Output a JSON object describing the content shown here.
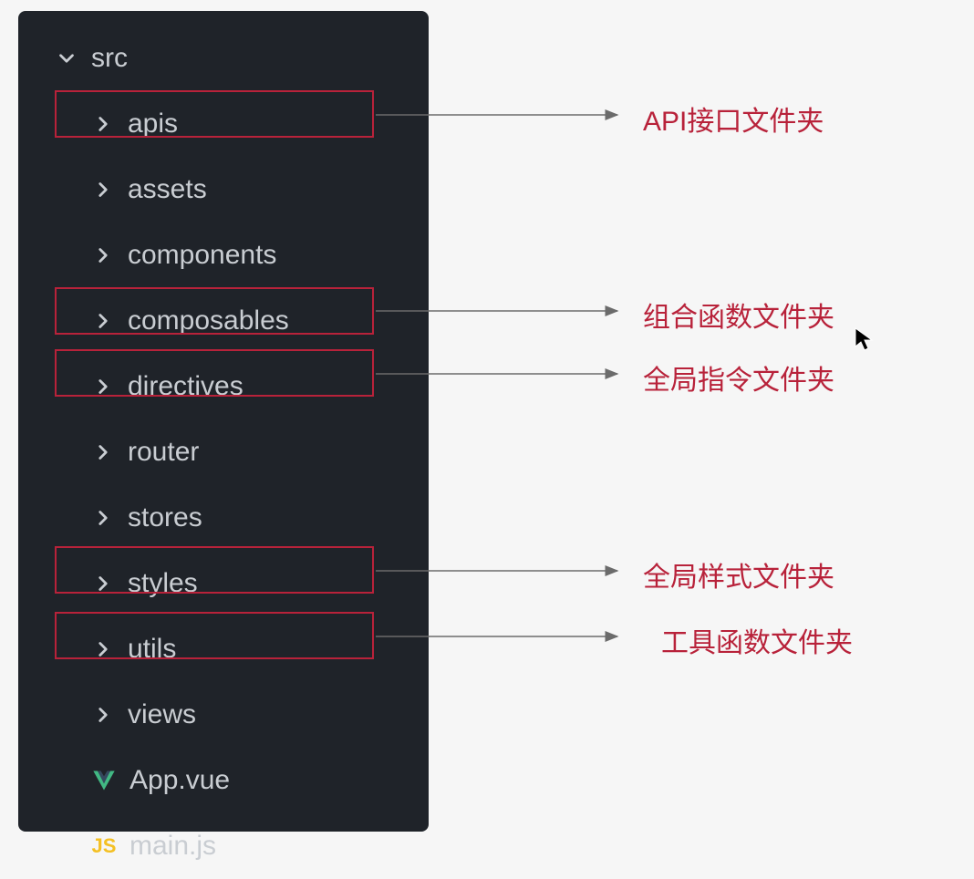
{
  "tree": {
    "root": "src",
    "folders": [
      {
        "name": "apis"
      },
      {
        "name": "assets"
      },
      {
        "name": "components"
      },
      {
        "name": "composables"
      },
      {
        "name": "directives"
      },
      {
        "name": "router"
      },
      {
        "name": "stores"
      },
      {
        "name": "styles"
      },
      {
        "name": "utils"
      },
      {
        "name": "views"
      }
    ],
    "files": [
      {
        "name": "App.vue",
        "type": "vue"
      },
      {
        "name": "main.js",
        "type": "js"
      }
    ]
  },
  "annotations": {
    "apis": "API接口文件夹",
    "composables": "组合函数文件夹",
    "directives": "全局指令文件夹",
    "styles": "全局样式文件夹",
    "utils": "工具函数文件夹"
  }
}
